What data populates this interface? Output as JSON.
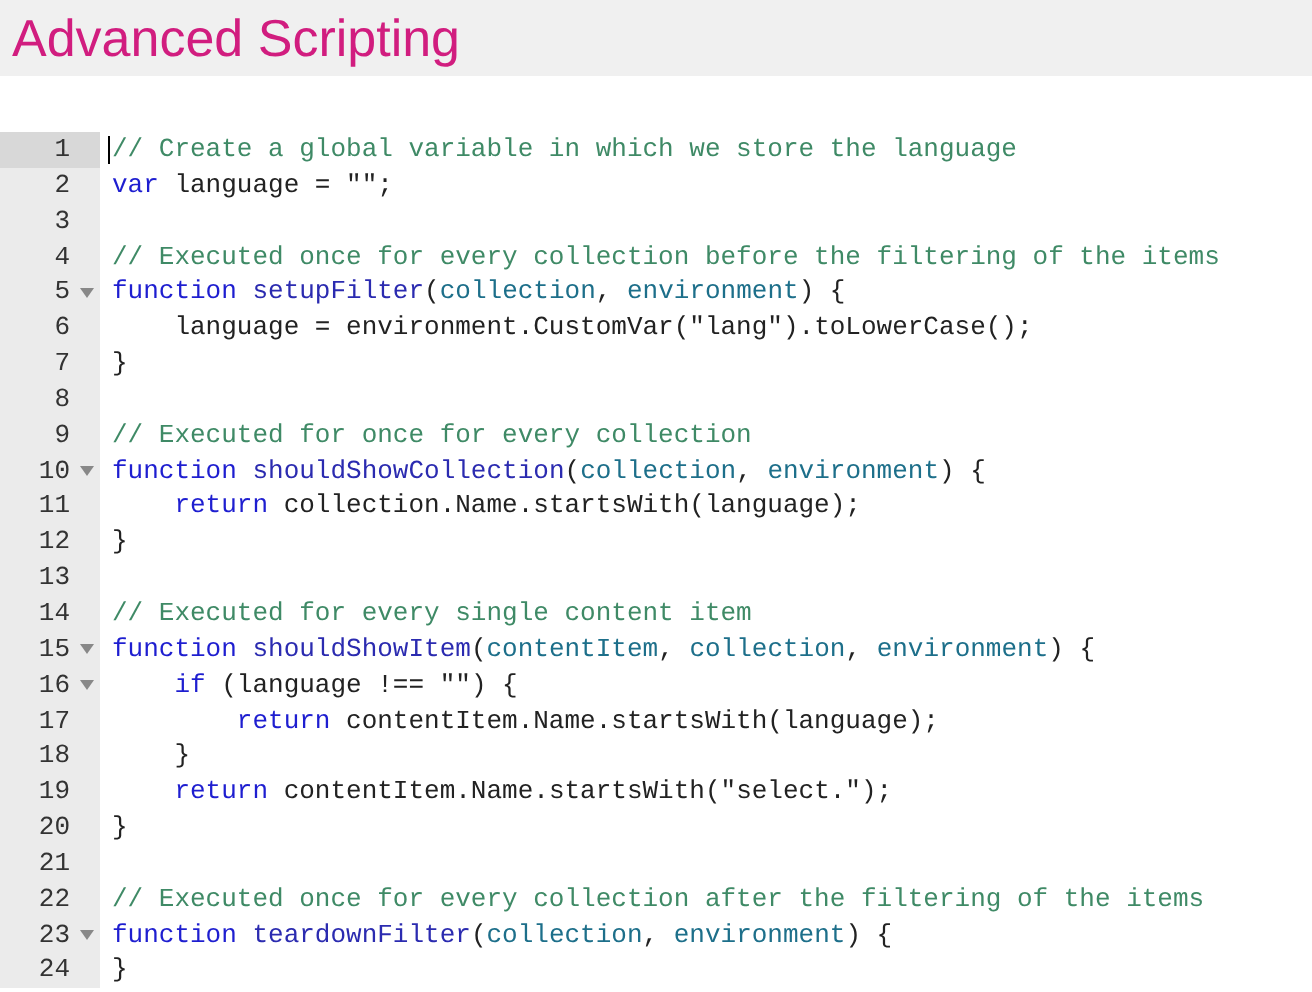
{
  "title": "Advanced Scripting",
  "editor": {
    "lines": [
      {
        "number": "1",
        "foldable": false,
        "active": true,
        "tokens": [
          {
            "kind": "comment",
            "text": "// Create a global variable in which we store the language"
          }
        ]
      },
      {
        "number": "2",
        "foldable": false,
        "active": false,
        "tokens": [
          {
            "kind": "keyword",
            "text": "var"
          },
          {
            "kind": "plain",
            "text": " language = "
          },
          {
            "kind": "string",
            "text": "\"\""
          },
          {
            "kind": "plain",
            "text": ";"
          }
        ]
      },
      {
        "number": "3",
        "foldable": false,
        "active": false
      },
      {
        "number": "4",
        "foldable": false,
        "active": false,
        "tokens": [
          {
            "kind": "comment",
            "text": "// Executed once for every collection before the filtering of the items"
          }
        ]
      },
      {
        "number": "5",
        "foldable": true,
        "active": false,
        "tokens": [
          {
            "kind": "keyword",
            "text": "function "
          },
          {
            "kind": "def",
            "text": "setupFilter"
          },
          {
            "kind": "plain",
            "text": "("
          },
          {
            "kind": "param",
            "text": "collection"
          },
          {
            "kind": "plain",
            "text": ", "
          },
          {
            "kind": "param",
            "text": "environment"
          },
          {
            "kind": "plain",
            "text": ") {"
          }
        ]
      },
      {
        "number": "6",
        "foldable": false,
        "active": false,
        "tokens": [
          {
            "kind": "plain",
            "text": "    language = environment.CustomVar("
          },
          {
            "kind": "string",
            "text": "\"lang\""
          },
          {
            "kind": "plain",
            "text": ").toLowerCase();"
          }
        ]
      },
      {
        "number": "7",
        "foldable": false,
        "active": false,
        "tokens": [
          {
            "kind": "plain",
            "text": "}"
          }
        ]
      },
      {
        "number": "8",
        "foldable": false,
        "active": false
      },
      {
        "number": "9",
        "foldable": false,
        "active": false,
        "tokens": [
          {
            "kind": "comment",
            "text": "// Executed for once for every collection"
          }
        ]
      },
      {
        "number": "10",
        "foldable": true,
        "active": false,
        "tokens": [
          {
            "kind": "keyword",
            "text": "function "
          },
          {
            "kind": "def",
            "text": "shouldShowCollection"
          },
          {
            "kind": "plain",
            "text": "("
          },
          {
            "kind": "param",
            "text": "collection"
          },
          {
            "kind": "plain",
            "text": ", "
          },
          {
            "kind": "param",
            "text": "environment"
          },
          {
            "kind": "plain",
            "text": ") {"
          }
        ]
      },
      {
        "number": "11",
        "foldable": false,
        "active": false,
        "tokens": [
          {
            "kind": "keyword",
            "text": "    return"
          },
          {
            "kind": "plain",
            "text": " collection.Name.startsWith(language);"
          }
        ]
      },
      {
        "number": "12",
        "foldable": false,
        "active": false,
        "tokens": [
          {
            "kind": "plain",
            "text": "}"
          }
        ]
      },
      {
        "number": "13",
        "foldable": false,
        "active": false
      },
      {
        "number": "14",
        "foldable": false,
        "active": false,
        "tokens": [
          {
            "kind": "comment",
            "text": "// Executed for every single content item"
          }
        ]
      },
      {
        "number": "15",
        "foldable": true,
        "active": false,
        "tokens": [
          {
            "kind": "keyword",
            "text": "function "
          },
          {
            "kind": "def",
            "text": "shouldShowItem"
          },
          {
            "kind": "plain",
            "text": "("
          },
          {
            "kind": "param",
            "text": "contentItem"
          },
          {
            "kind": "plain",
            "text": ", "
          },
          {
            "kind": "param",
            "text": "collection"
          },
          {
            "kind": "plain",
            "text": ", "
          },
          {
            "kind": "param",
            "text": "environment"
          },
          {
            "kind": "plain",
            "text": ") {"
          }
        ]
      },
      {
        "number": "16",
        "foldable": true,
        "active": false,
        "tokens": [
          {
            "kind": "keyword",
            "text": "    if"
          },
          {
            "kind": "plain",
            "text": " (language !== "
          },
          {
            "kind": "string",
            "text": "\"\""
          },
          {
            "kind": "plain",
            "text": ") {"
          }
        ]
      },
      {
        "number": "17",
        "foldable": false,
        "active": false,
        "tokens": [
          {
            "kind": "keyword",
            "text": "        return"
          },
          {
            "kind": "plain",
            "text": " contentItem.Name.startsWith(language);"
          }
        ]
      },
      {
        "number": "18",
        "foldable": false,
        "active": false,
        "tokens": [
          {
            "kind": "plain",
            "text": "    }"
          }
        ]
      },
      {
        "number": "19",
        "foldable": false,
        "active": false,
        "tokens": [
          {
            "kind": "keyword",
            "text": "    return"
          },
          {
            "kind": "plain",
            "text": " contentItem.Name.startsWith("
          },
          {
            "kind": "string",
            "text": "\"select.\""
          },
          {
            "kind": "plain",
            "text": ");"
          }
        ]
      },
      {
        "number": "20",
        "foldable": false,
        "active": false,
        "tokens": [
          {
            "kind": "plain",
            "text": "}"
          }
        ]
      },
      {
        "number": "21",
        "foldable": false,
        "active": false
      },
      {
        "number": "22",
        "foldable": false,
        "active": false,
        "tokens": [
          {
            "kind": "comment",
            "text": "// Executed once for every collection after the filtering of the items"
          }
        ]
      },
      {
        "number": "23",
        "foldable": true,
        "active": false,
        "tokens": [
          {
            "kind": "keyword",
            "text": "function "
          },
          {
            "kind": "def",
            "text": "teardownFilter"
          },
          {
            "kind": "plain",
            "text": "("
          },
          {
            "kind": "param",
            "text": "collection"
          },
          {
            "kind": "plain",
            "text": ", "
          },
          {
            "kind": "param",
            "text": "environment"
          },
          {
            "kind": "plain",
            "text": ") {"
          }
        ]
      },
      {
        "number": "24",
        "foldable": false,
        "active": false,
        "tokens": [
          {
            "kind": "plain",
            "text": "}"
          }
        ]
      }
    ]
  }
}
